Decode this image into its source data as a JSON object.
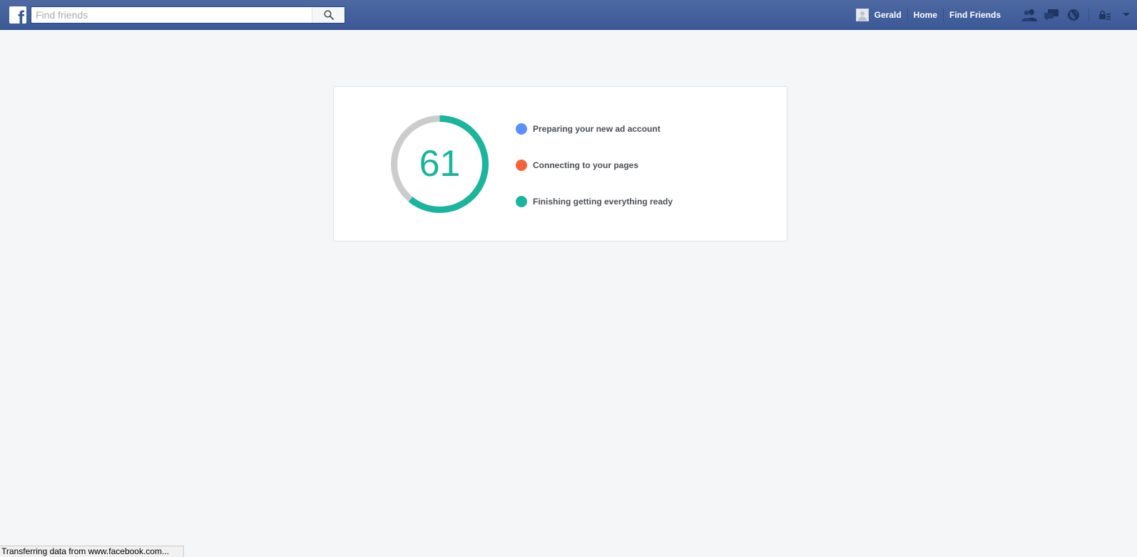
{
  "header": {
    "logo_letter": "f",
    "search": {
      "placeholder": "Find friends",
      "value": ""
    },
    "user_name": "Gerald",
    "nav_links": [
      "Home",
      "Find Friends"
    ],
    "icons": [
      "friend-requests-icon",
      "messages-icon",
      "notifications-icon",
      "privacy-shortcuts-icon",
      "account-menu-icon"
    ],
    "brand_color": "#3b5998"
  },
  "progress": {
    "value": "61",
    "percent": 61,
    "track_color": "#cccccc",
    "fill_color": "#1ab59c",
    "steps": [
      {
        "label": "Preparing your new ad account",
        "color": "#5890ff"
      },
      {
        "label": "Connecting to your pages",
        "color": "#f7623b"
      },
      {
        "label": "Finishing getting everything ready",
        "color": "#1ab59c"
      }
    ]
  },
  "status_bar": {
    "text": "Transferring data from www.facebook.com..."
  }
}
